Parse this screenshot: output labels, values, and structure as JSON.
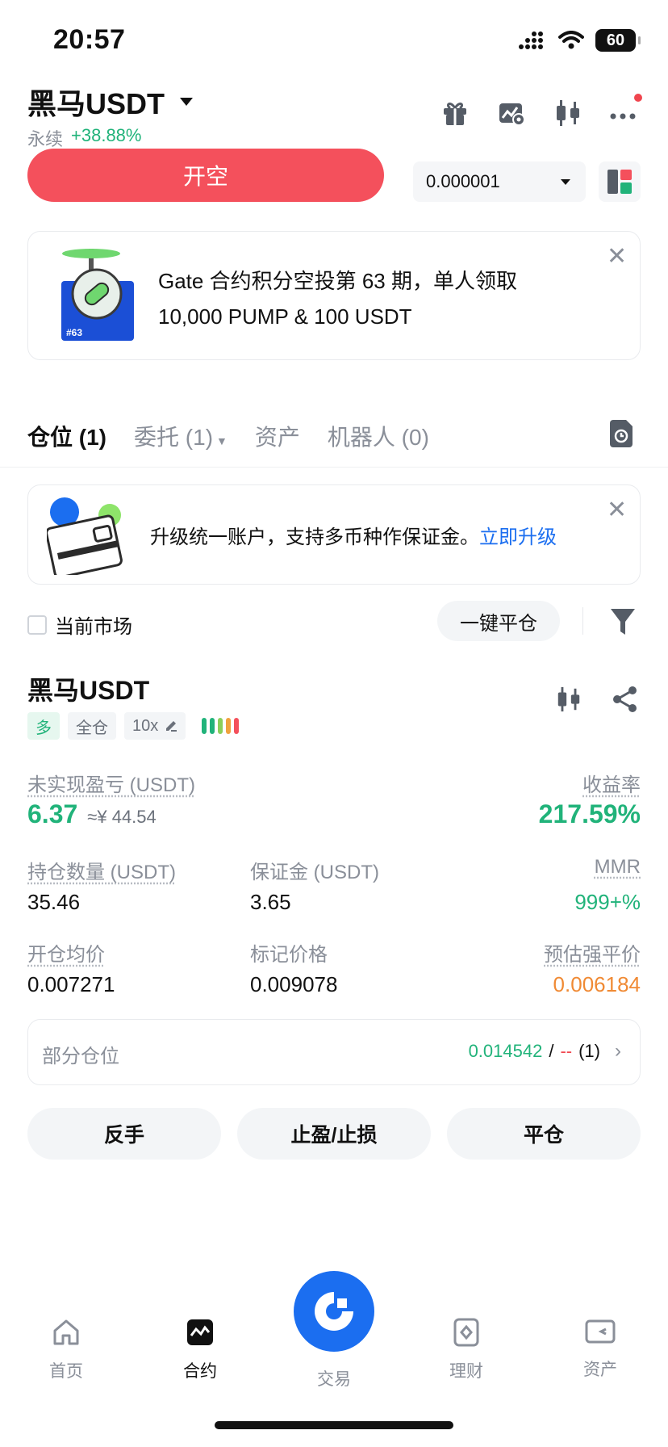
{
  "status_bar": {
    "time": "20:57",
    "battery": "60"
  },
  "header": {
    "pair": "黑马USDT",
    "type": "永续",
    "change": "+38.88%",
    "icons": [
      "gift-icon",
      "chart-settings-icon",
      "candlestick-icon",
      "more-icon"
    ]
  },
  "order": {
    "short_label": "开空",
    "price_precision": "0.000001"
  },
  "promo": {
    "line1": "Gate 合约积分空投第 63 期，单人领取",
    "line2": "10,000 PUMP & 100 USDT",
    "badge": "#63"
  },
  "tabs": [
    {
      "label": "仓位 (1)"
    },
    {
      "label": "委托 (1)"
    },
    {
      "label": "资产"
    },
    {
      "label": "机器人 (0)"
    }
  ],
  "upgrade": {
    "text": "升级统一账户，支持多币种作保证金。",
    "link": "立即升级"
  },
  "filter": {
    "current_market": "当前市场",
    "close_all": "一键平仓"
  },
  "position": {
    "name": "黑马USDT",
    "tags": {
      "side": "多",
      "mode": "全仓",
      "leverage": "10x"
    },
    "unrealized_pnl_label": "未实现盈亏 (USDT)",
    "unrealized_pnl": "6.37",
    "unrealized_pnl_cny": "≈¥ 44.54",
    "roe_label": "收益率",
    "roe": "217.59%",
    "size_label": "持仓数量 (USDT)",
    "size": "35.46",
    "margin_label": "保证金 (USDT)",
    "margin": "3.65",
    "mmr_label": "MMR",
    "mmr": "999+%",
    "entry_label": "开仓均价",
    "entry": "0.007271",
    "mark_label": "标记价格",
    "mark": "0.009078",
    "liq_label": "预估强平价",
    "liq": "0.006184",
    "partial_label": "部分仓位",
    "partial_tp": "0.014542",
    "partial_sep": "/",
    "partial_sl": "--",
    "partial_count": "(1)"
  },
  "actions": {
    "reverse": "反手",
    "tpsl": "止盈/止损",
    "close": "平仓"
  },
  "nav": {
    "home": "首页",
    "futures": "合约",
    "trade": "交易",
    "earn": "理财",
    "assets": "资产"
  },
  "colors": {
    "green": "#21b37a",
    "red": "#f4505c",
    "orange": "#f08a34",
    "blue": "#1b6ef0"
  }
}
